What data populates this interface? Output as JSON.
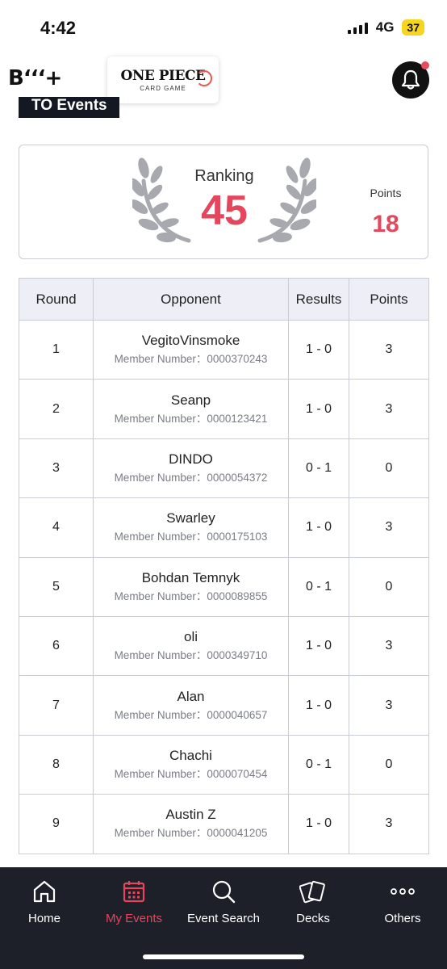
{
  "status_bar": {
    "time": "4:42",
    "network": "4G",
    "battery": "37"
  },
  "header": {
    "brand_logo_text": "B‘‘‘+",
    "game_logo_title": "ONE PIECE",
    "game_logo_subtitle": "CARD GAME",
    "notification_icon": "bell-icon"
  },
  "section": {
    "title": "TO Events"
  },
  "ranking": {
    "label": "Ranking",
    "value": "45",
    "points_label": "Points",
    "points_value": "18"
  },
  "table": {
    "headers": [
      "Round",
      "Opponent",
      "Results",
      "Points"
    ],
    "member_prefix": "Member Number：",
    "rows": [
      {
        "round": "1",
        "opponent": "VegitoVinsmoke",
        "member": "Member Number：0000370243",
        "result": "1 - 0",
        "points": "3"
      },
      {
        "round": "2",
        "opponent": "Seanp",
        "member": "Member Number：0000123421",
        "result": "1 - 0",
        "points": "3"
      },
      {
        "round": "3",
        "opponent": "DINDO",
        "member": "Member Number：0000054372",
        "result": "0 - 1",
        "points": "0"
      },
      {
        "round": "4",
        "opponent": "Swarley",
        "member": "Member Number：0000175103",
        "result": "1 - 0",
        "points": "3"
      },
      {
        "round": "5",
        "opponent": "Bohdan Temnyk",
        "member": "Member Number：0000089855",
        "result": "0 - 1",
        "points": "0"
      },
      {
        "round": "6",
        "opponent": "oli",
        "member": "Member Number：0000349710",
        "result": "1 - 0",
        "points": "3"
      },
      {
        "round": "7",
        "opponent": "Alan",
        "member": "Member Number：0000040657",
        "result": "1 - 0",
        "points": "3"
      },
      {
        "round": "8",
        "opponent": "Chachi",
        "member": "Member Number：0000070454",
        "result": "0 - 1",
        "points": "0"
      },
      {
        "round": "9",
        "opponent": "Austin Z",
        "member": "Member Number：0000041205",
        "result": "1 - 0",
        "points": "3"
      }
    ]
  },
  "bottom_nav": {
    "items": [
      {
        "label": "Home",
        "icon": "home-icon",
        "active": false
      },
      {
        "label": "My Events",
        "icon": "calendar-icon",
        "active": true
      },
      {
        "label": "Event Search",
        "icon": "search-icon",
        "active": false
      },
      {
        "label": "Decks",
        "icon": "cards-icon",
        "active": false
      },
      {
        "label": "Others",
        "icon": "more-icon",
        "active": false
      }
    ]
  },
  "colors": {
    "accent": "#e4475d",
    "nav_background": "#1d2029",
    "header_row": "#eeeff6",
    "border": "#c9ccd6"
  }
}
